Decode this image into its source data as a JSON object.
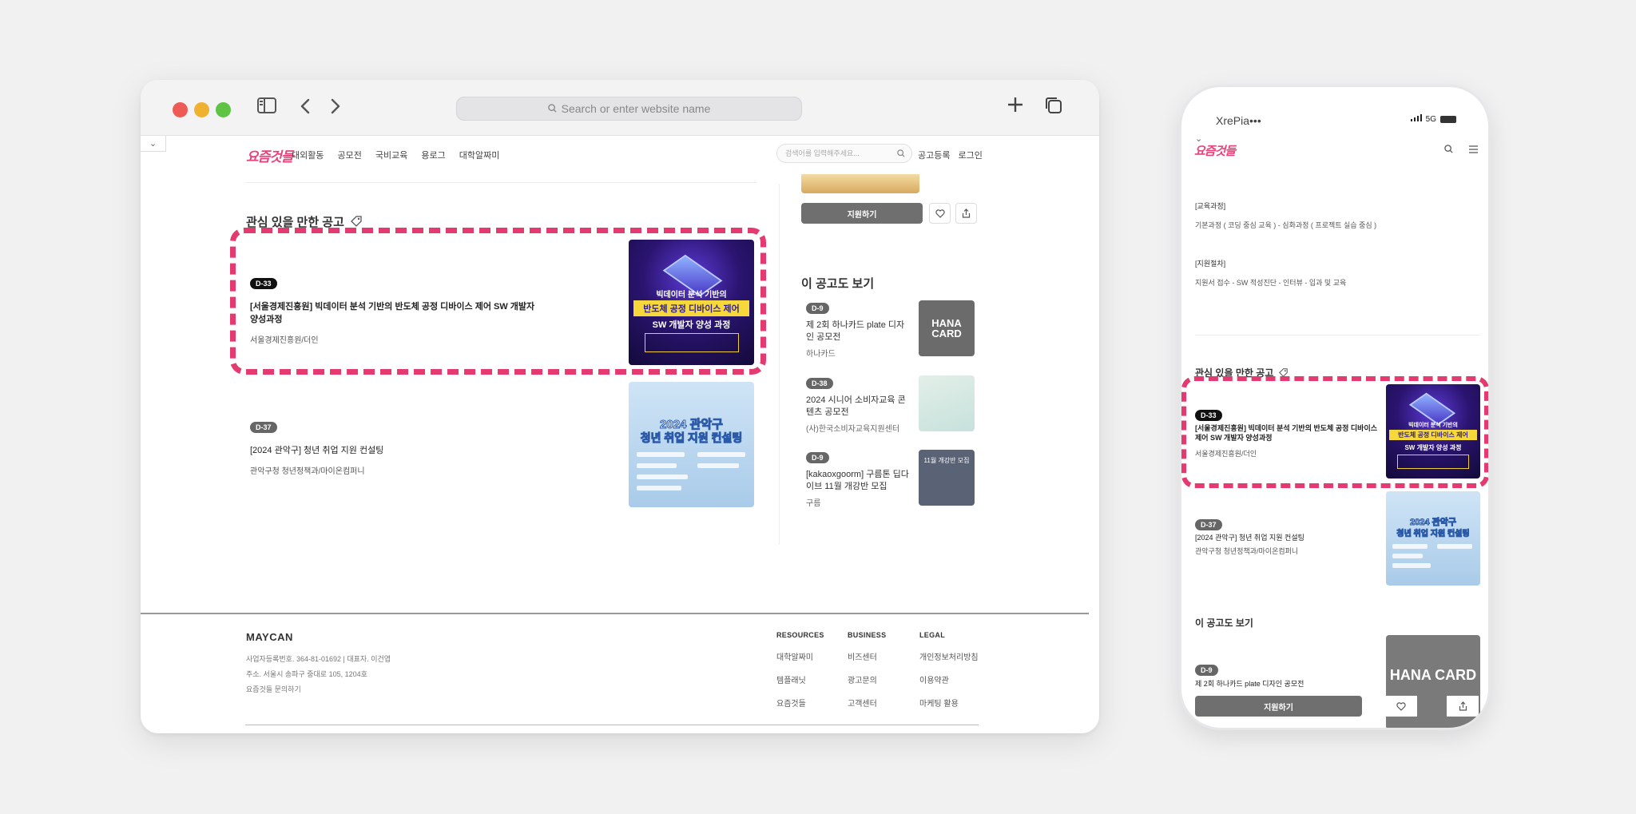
{
  "browser": {
    "url_placeholder": "Search or enter website name",
    "collapse_label": "⌄"
  },
  "site": {
    "logo": "요즘것들",
    "nav": [
      "대외활동",
      "공모전",
      "국비교육",
      "용로그",
      "대학알짜미"
    ],
    "search_placeholder": "검색어를 입력해주세요...",
    "nav_right": [
      "공고등록",
      "로그인"
    ]
  },
  "main": {
    "section_title": "관심 있을 만한 공고",
    "cards": [
      {
        "badge": "D-33",
        "title": "[서울경제진흥원] 빅데이터 분석 기반의 반도체 공정 디바이스 제어 SW 개발자 양성과정",
        "org": "서울경제진흥원/더인",
        "poster": {
          "line1": "빅데이터 분석 기반의",
          "line2": "반도체 공정 디바이스 제어",
          "line3": "SW 개발자 양성 과정"
        }
      },
      {
        "badge": "D-37",
        "title": "[2024 관악구] 청년 취업 지원 컨설팅",
        "org": "관악구청 청년정책과/마이온컴퍼니",
        "poster": {
          "line1": "2024 관악구",
          "line2": "청년 취업 지원 컨설팅"
        }
      }
    ]
  },
  "sidebar": {
    "apply_label": "지원하기",
    "heart_icon": "heart-icon",
    "share_icon": "share-icon",
    "also_title": "이 공고도 보기",
    "items": [
      {
        "badge": "D-9",
        "title": "제 2회 하나카드 plate 디자인 공모전",
        "org": "하나카드",
        "thumb_text": "HANA CARD",
        "thumb_color": "#6b6b6b"
      },
      {
        "badge": "D-38",
        "title": "2024 시니어 소비자교육 콘텐츠 공모전",
        "org": "(사)한국소비자교육지원센터",
        "thumb_text": "",
        "thumb_color": "#cfe3df"
      },
      {
        "badge": "D-9",
        "title": "[kakaoxgoorm] 구름톤 딥다이브 11월 개강반 모집",
        "org": "구름",
        "thumb_text": "11월 개강반 모집",
        "thumb_color": "#5a6275"
      }
    ]
  },
  "footer": {
    "logo": "MAYCAN",
    "info": [
      "사업자등록번호. 364-81-01692 | 대표자. 이건엽",
      "주소. 서울시 송파구 중대로 105, 1204호",
      "요즘것들 문의하기"
    ],
    "columns": [
      {
        "heading": "RESOURCES",
        "links": [
          "대학알짜미",
          "템플래닛",
          "요즘것들"
        ]
      },
      {
        "heading": "BUSINESS",
        "links": [
          "비즈센터",
          "광고문의",
          "고객센터"
        ]
      },
      {
        "heading": "LEGAL",
        "links": [
          "개인정보처리방침",
          "이용약관",
          "마케팅 활용"
        ]
      }
    ]
  },
  "phone": {
    "carrier": "XrePia•••",
    "network": "5G",
    "logo": "요즘것들",
    "course_heading": "[교육과정]",
    "course_text": "기본과정 ( 코딩 중심 교육 ) - 심화과정 ( 프로젝트 실습 중심 )",
    "process_heading": "[지원절차]",
    "process_text": "지원서 접수 - SW 적성진단 - 인터뷰 - 입과 및 교육",
    "section_title": "관심 있을 만한 공고",
    "cards": [
      {
        "badge": "D-33",
        "title": "[서울경제진흥원] 빅데이터 분석 기반의 반도체 공정 디바이스 제어 SW 개발자 양성과정",
        "org": "서울경제진흥원/더인"
      },
      {
        "badge": "D-37",
        "title": "[2024 관악구] 청년 취업 지원 컨설팅",
        "org": "관악구청 청년정책과/마이온컴퍼니"
      }
    ],
    "also_title": "이 공고도 보기",
    "also_item": {
      "badge": "D-9",
      "title": "제 2회 하나카드 plate 디자인 공모전",
      "thumb_text": "HANA CARD"
    },
    "apply_label": "지원하기"
  },
  "colors": {
    "accent": "#e43a6f",
    "logo": "#e8437a",
    "badge": "#111111",
    "button": "#6f6f6f"
  }
}
